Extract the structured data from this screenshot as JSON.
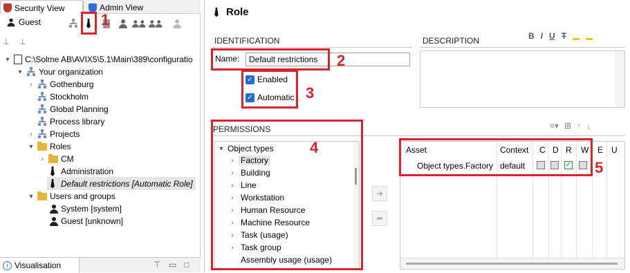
{
  "left": {
    "tabs": [
      {
        "label": "Security View",
        "icon": "shield-icon"
      },
      {
        "label": "Admin View",
        "icon": "shield-icon"
      }
    ],
    "guest_label": "Guest",
    "tree": [
      {
        "label": "C:\\Solme AB\\AVIX5\\5.1\\Main\\389\\configuratio",
        "icon": "database-icon"
      },
      {
        "label": "Your organization",
        "icon": "org-icon"
      },
      {
        "label": "Gothenburg",
        "icon": "org-icon"
      },
      {
        "label": "Stockholm",
        "icon": "org-icon"
      },
      {
        "label": "Global Planning",
        "icon": "org-icon"
      },
      {
        "label": "Process library",
        "icon": "org-icon"
      },
      {
        "label": "Projects",
        "icon": "org-icon"
      },
      {
        "label": "Roles",
        "icon": "folder-icon"
      },
      {
        "label": "CM",
        "icon": "folder-icon"
      },
      {
        "label": "Administration",
        "icon": "tie-icon"
      },
      {
        "label": "Default restrictions [Automatic Role]",
        "icon": "tie-icon"
      },
      {
        "label": "Users and groups",
        "icon": "folder-icon"
      },
      {
        "label": "System [system]",
        "icon": "person-icon"
      },
      {
        "label": "Guest [unknown]",
        "icon": "person-icon"
      }
    ],
    "visualisation_tab": "Visualisation"
  },
  "right": {
    "title": "Role",
    "identification": "IDENTIFICATION",
    "description": "DESCRIPTION",
    "name_label": "Name:",
    "name_value": "Default restrictions",
    "enabled_label": "Enabled",
    "automatic_label": "Automatic",
    "permissions": "PERMISSIONS",
    "format_icons": [
      "B",
      "I",
      "U",
      "T"
    ],
    "object_types_label": "Object types",
    "object_types": [
      "Factory",
      "Building",
      "Line",
      "Workstation",
      "Human Resource",
      "Machine Resource",
      "Task (usage)",
      "Task group",
      "Assembly usage (usage)"
    ],
    "grid_headers": [
      "Asset",
      "Context",
      "C",
      "D",
      "R",
      "W",
      "E",
      "U"
    ],
    "grid_row": {
      "asset": "Object types.Factory",
      "context": "default"
    }
  },
  "annotations": [
    "1",
    "2",
    "3",
    "4",
    "5"
  ]
}
